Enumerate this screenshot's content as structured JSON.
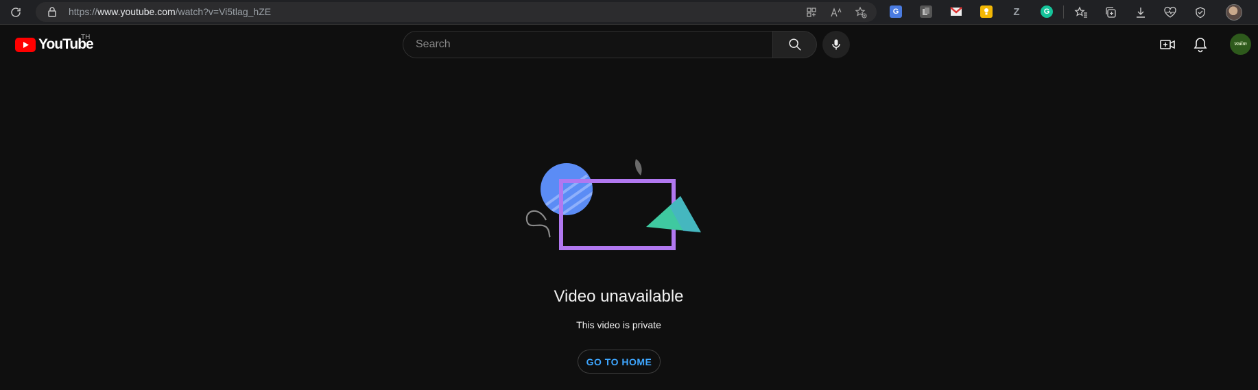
{
  "browser": {
    "url_scheme": "https://",
    "url_domain": "www.youtube.com",
    "url_path": "/watch?v=Vi5tlag_hZE",
    "icons": [
      "reload-icon",
      "lock-icon",
      "app-available-icon",
      "read-aloud-icon",
      "favorite-add-icon",
      "google-translate-icon",
      "extension-icon",
      "gmail-icon",
      "google-keep-icon",
      "zotero-icon",
      "grammarly-icon",
      "favorites-icon",
      "collections-icon",
      "downloads-icon",
      "browser-essentials-icon",
      "security-icon",
      "profile-icon"
    ]
  },
  "masthead": {
    "logo_text": "YouTube",
    "country_code": "TH",
    "search_placeholder": "Search",
    "avatar_text": "Vaiim"
  },
  "main": {
    "title": "Video unavailable",
    "subtitle": "This video is private",
    "home_button_label": "GO TO HOME"
  },
  "colors": {
    "background": "#0f0f0f",
    "browser_bar": "#202124",
    "link_blue": "#3ea6ff",
    "youtube_red": "#ff0000",
    "illustration_purple": "#b178f0",
    "illustration_blue": "#5b8cf5",
    "illustration_green": "#3fc9a0"
  }
}
